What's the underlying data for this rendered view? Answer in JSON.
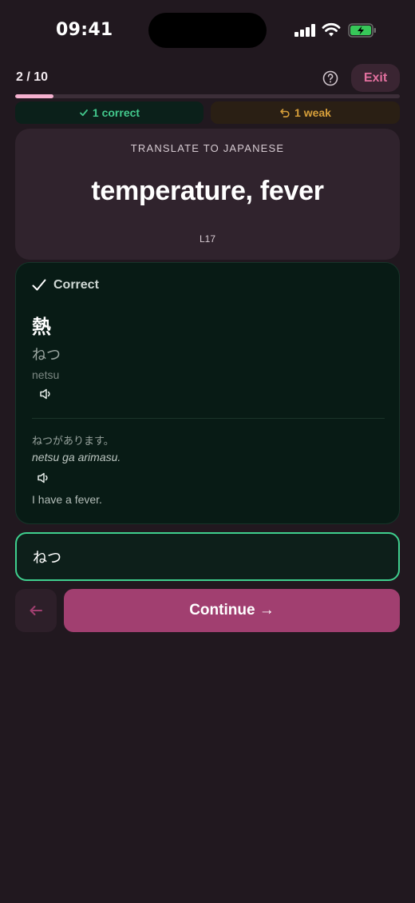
{
  "status_bar": {
    "time": "09:41"
  },
  "header": {
    "progress_text": "2 / 10",
    "progress_fraction": 0.1,
    "help_icon": "question-circle-icon",
    "exit_label": "Exit"
  },
  "tally": {
    "correct_label": "1 correct",
    "weak_label": "1 weak"
  },
  "prompt": {
    "eyebrow": "TRANSLATE TO JAPANESE",
    "word": "temperature, fever",
    "lesson": "L17"
  },
  "result": {
    "status": "Correct",
    "kanji": "熱",
    "kana": "ねつ",
    "romaji": "netsu",
    "example": {
      "japanese": "ねつがあります。",
      "romaji": "netsu ga arimasu.",
      "english": "I have a fever."
    }
  },
  "answer": {
    "value": "ねつ"
  },
  "actions": {
    "back_icon": "arrow-left-icon",
    "continue_label": "Continue →"
  },
  "colors": {
    "background": "#21181f",
    "accent_pink": "#a13f70",
    "success_green": "#43c98d",
    "warning_amber": "#d79f3a"
  }
}
